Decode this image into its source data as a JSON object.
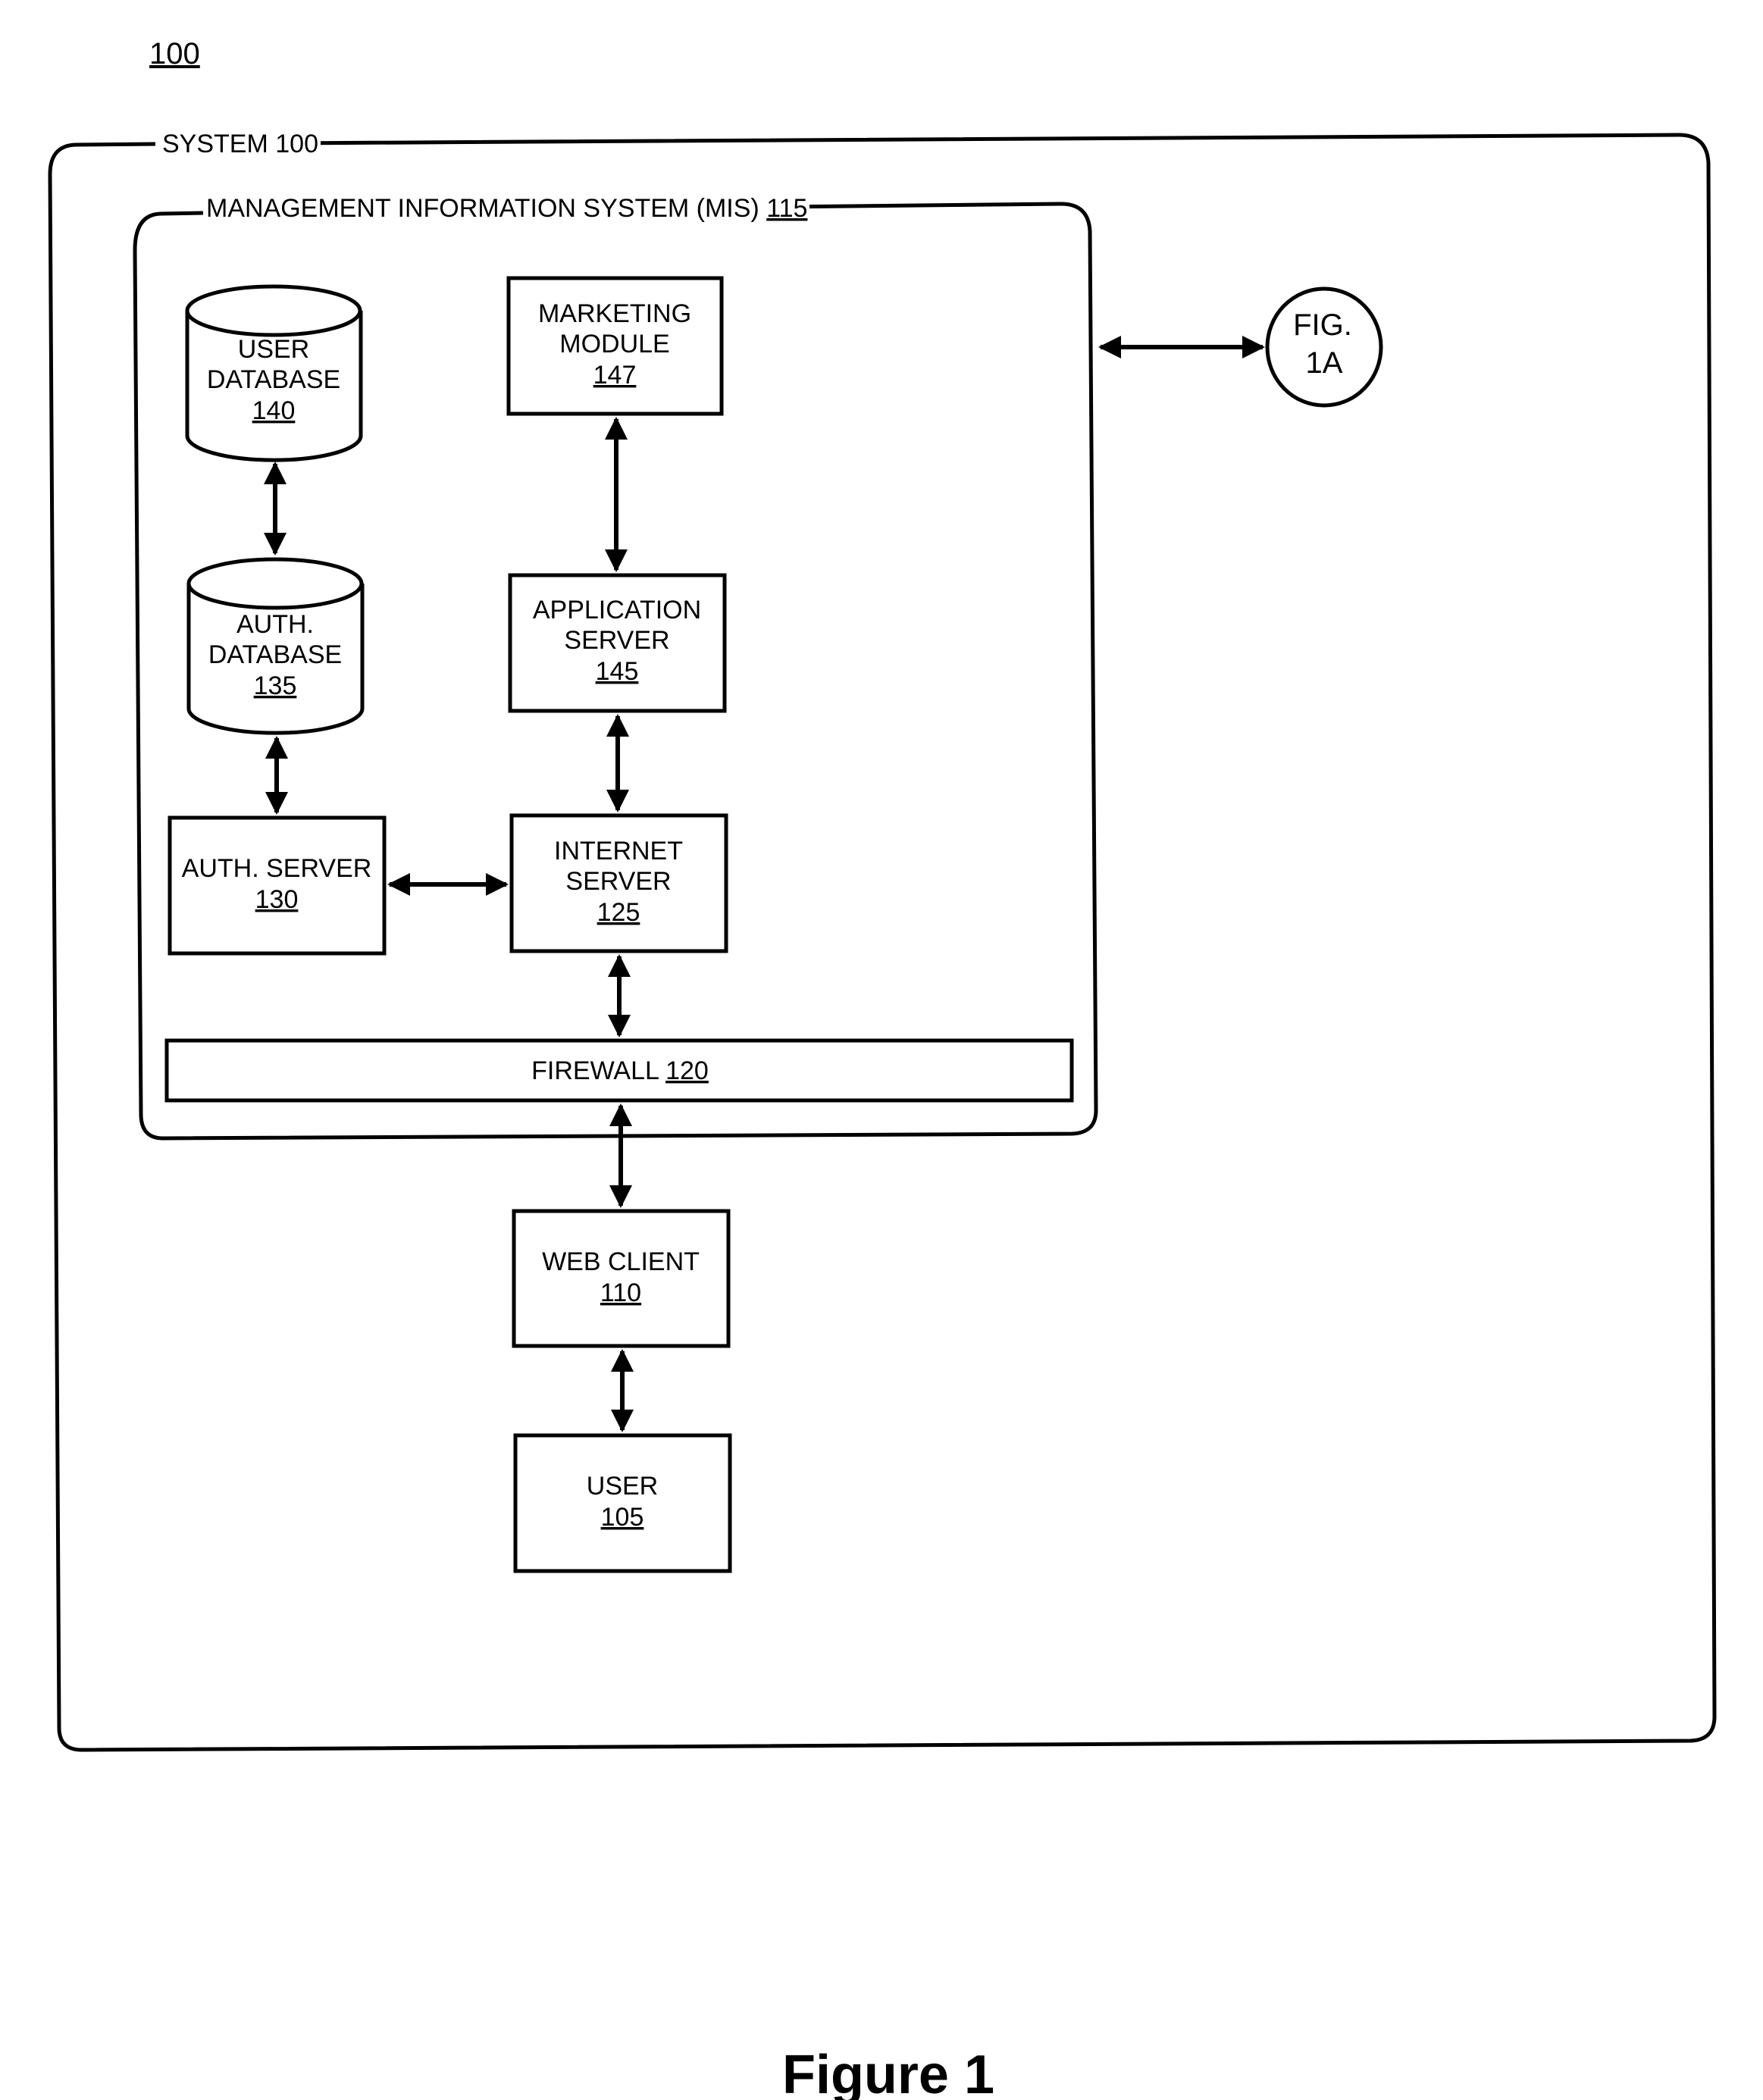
{
  "figure_number": "100",
  "caption": "Figure 1",
  "system": {
    "label": "SYSTEM",
    "ref": "100"
  },
  "mis": {
    "label": "MANAGEMENT INFORMATION SYSTEM (MIS)",
    "ref": "115"
  },
  "components": {
    "user_database": {
      "lines": [
        "USER",
        "DATABASE"
      ],
      "ref": "140",
      "shape": "cylinder"
    },
    "auth_database": {
      "lines": [
        "AUTH.",
        "DATABASE"
      ],
      "ref": "135",
      "shape": "cylinder"
    },
    "marketing_module": {
      "lines": [
        "MARKETING",
        "MODULE"
      ],
      "ref": "147",
      "shape": "box"
    },
    "application_server": {
      "lines": [
        "APPLICATION",
        "SERVER"
      ],
      "ref": "145",
      "shape": "box"
    },
    "auth_server": {
      "lines": [
        "AUTH. SERVER"
      ],
      "ref": "130",
      "shape": "box"
    },
    "internet_server": {
      "lines": [
        "INTERNET",
        "SERVER"
      ],
      "ref": "125",
      "shape": "box"
    },
    "firewall": {
      "label": "FIREWALL",
      "ref": "120",
      "shape": "bar"
    },
    "web_client": {
      "lines": [
        "WEB CLIENT"
      ],
      "ref": "110",
      "shape": "box"
    },
    "user": {
      "lines": [
        "USER"
      ],
      "ref": "105",
      "shape": "box"
    }
  },
  "connector": {
    "lines": [
      "FIG.",
      "1A"
    ]
  },
  "connections": [
    {
      "from": "user_database",
      "to": "auth_database",
      "type": "bidirectional"
    },
    {
      "from": "marketing_module",
      "to": "application_server",
      "type": "bidirectional"
    },
    {
      "from": "auth_database",
      "to": "auth_server",
      "type": "bidirectional"
    },
    {
      "from": "application_server",
      "to": "internet_server",
      "type": "bidirectional"
    },
    {
      "from": "auth_server",
      "to": "internet_server",
      "type": "bidirectional"
    },
    {
      "from": "internet_server",
      "to": "firewall",
      "type": "bidirectional"
    },
    {
      "from": "firewall",
      "to": "web_client",
      "type": "bidirectional"
    },
    {
      "from": "web_client",
      "to": "user",
      "type": "bidirectional"
    },
    {
      "from": "mis",
      "to": "connector",
      "type": "bidirectional"
    }
  ]
}
